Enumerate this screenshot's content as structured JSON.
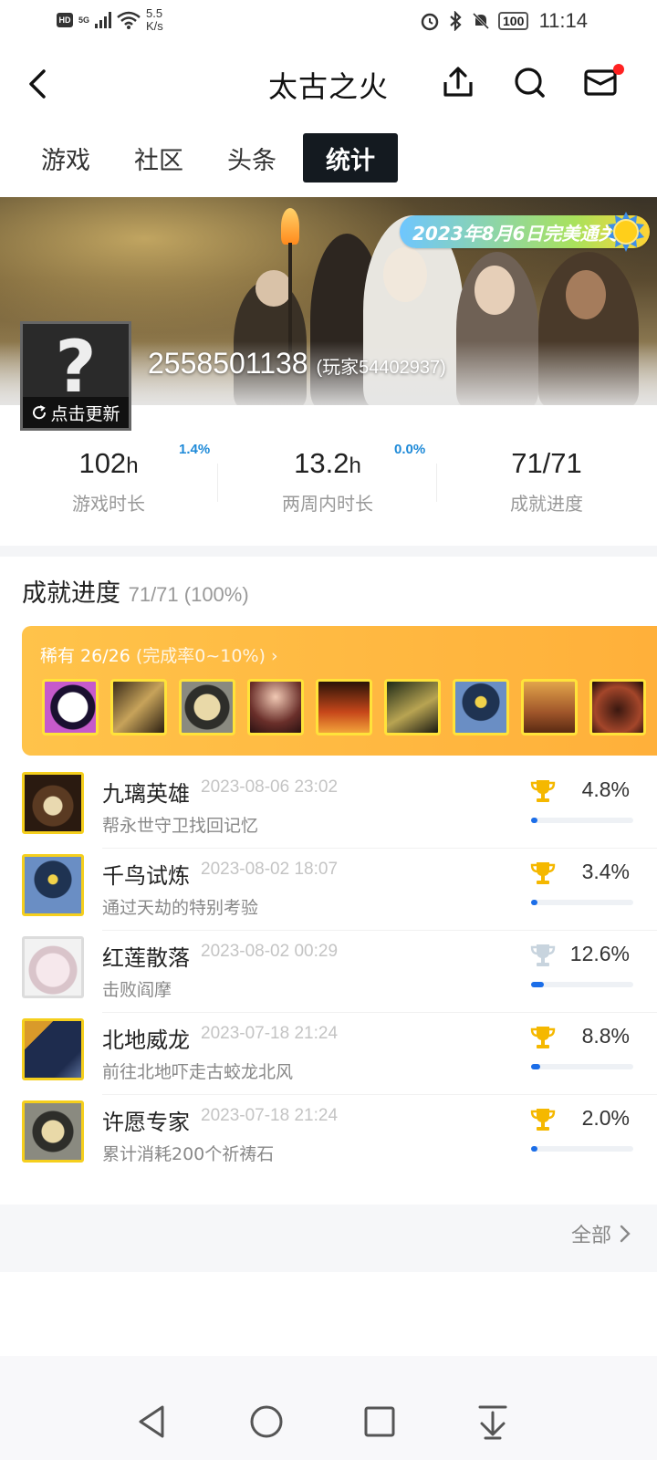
{
  "status": {
    "hd": "HD",
    "net_5g": "5G",
    "speed_line1": "5.5",
    "speed_line2": "K/s",
    "battery": "100",
    "time": "11:14"
  },
  "header": {
    "title": "太古之火",
    "icons": [
      "back-icon",
      "share-icon",
      "search-icon",
      "mail-icon"
    ]
  },
  "tabs": [
    {
      "label": "游戏",
      "active": false
    },
    {
      "label": "社区",
      "active": false
    },
    {
      "label": "头条",
      "active": false
    },
    {
      "label": "统计",
      "active": true
    }
  ],
  "banner": {
    "badge": "2023年8月6日完美通关",
    "update_label": "点击更新",
    "user_id": "2558501138",
    "player_name": "(玩家54402937)"
  },
  "stats": [
    {
      "value": "102",
      "unit": "h",
      "label": "游戏时长",
      "change": "1.4%"
    },
    {
      "value": "13.2",
      "unit": "h",
      "label": "两周内时长",
      "change": "0.0%"
    },
    {
      "value": "71/71",
      "unit": "",
      "label": "成就进度",
      "change": ""
    }
  ],
  "achievements": {
    "title": "成就进度",
    "summary": "71/71 (100%)",
    "rare_label": "稀有 26/26",
    "rare_range": "(完成率0~10%) ›",
    "list": [
      {
        "name": "九璃英雄",
        "date": "2023-08-06 23:02",
        "desc": "帮永世守卫找回记忆",
        "percent": "4.8%",
        "fraction": 0.048,
        "trophy": "gold"
      },
      {
        "name": "千鸟试炼",
        "date": "2023-08-02 18:07",
        "desc": "通过天劫的特别考验",
        "percent": "3.4%",
        "fraction": 0.034,
        "trophy": "gold"
      },
      {
        "name": "红莲散落",
        "date": "2023-08-02 00:29",
        "desc": "击败阎摩",
        "percent": "12.6%",
        "fraction": 0.126,
        "trophy": "silver"
      },
      {
        "name": "北地威龙",
        "date": "2023-07-18 21:24",
        "desc": "前往北地吓走古蛟龙北风",
        "percent": "8.8%",
        "fraction": 0.088,
        "trophy": "gold"
      },
      {
        "name": "许愿专家",
        "date": "2023-07-18 21:24",
        "desc": "累计消耗200个祈祷石",
        "percent": "2.0%",
        "fraction": 0.02,
        "trophy": "gold"
      }
    ],
    "all_label": "全部"
  },
  "colors": {
    "accent_blue": "#1c6ee8",
    "rare_orange": "#ffb53f",
    "tab_active_bg": "#141a20",
    "gold_trophy": "#f5b800",
    "silver_trophy": "#c8d4de"
  }
}
